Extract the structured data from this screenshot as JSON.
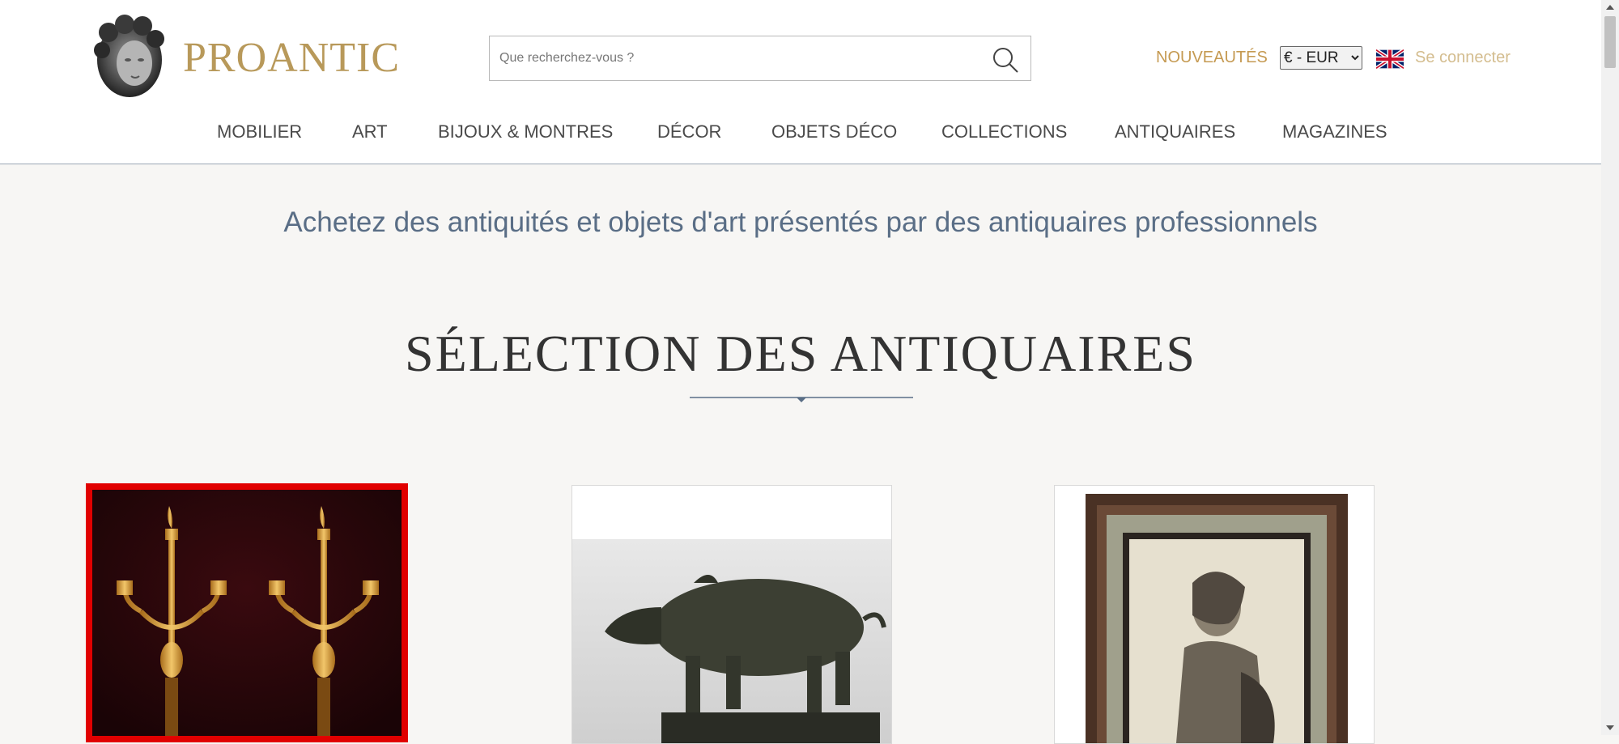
{
  "header": {
    "brand": "PROANTIC",
    "search_placeholder": "Que recherchez-vous ?",
    "new_label": "NOUVEAUTÉS",
    "currency_selected": "€ - EUR",
    "login_label": "Se connecter",
    "language_flag": "uk-flag-icon"
  },
  "nav": {
    "items": [
      {
        "label": "MOBILIER"
      },
      {
        "label": "ART"
      },
      {
        "label": "BIJOUX & MONTRES"
      },
      {
        "label": "DÉCOR"
      },
      {
        "label": "OBJETS DÉCO"
      },
      {
        "label": "COLLECTIONS"
      },
      {
        "label": "ANTIQUAIRES"
      },
      {
        "label": "MAGAZINES"
      }
    ]
  },
  "main": {
    "tagline": "Achetez des antiquités et objets d'art présentés par des antiquaires professionnels",
    "section_title": "SÉLECTION DES ANTIQUAIRES",
    "cards": [
      {
        "subject": "gilt-bronze-candelabra-pair"
      },
      {
        "subject": "bronze-boar-sculpture"
      },
      {
        "subject": "framed-portrait-drawing"
      }
    ]
  },
  "colors": {
    "brand_gold": "#b8995a",
    "accent_gold": "#c59a52",
    "tagline_blue": "#5a6e86",
    "selection_red": "#e10000"
  }
}
